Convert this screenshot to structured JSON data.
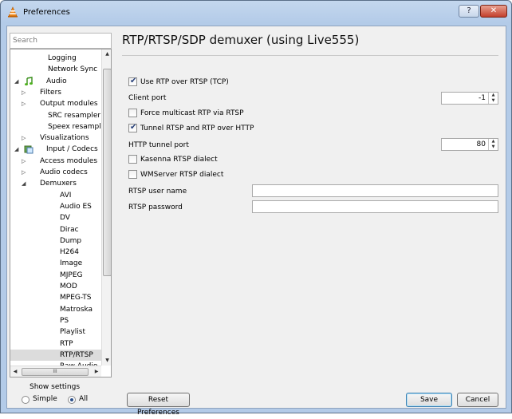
{
  "window": {
    "title": "Preferences",
    "help_glyph": "?",
    "close_glyph": "✕"
  },
  "search": {
    "placeholder": "Search"
  },
  "tree": {
    "items": [
      {
        "label": "Logging",
        "indent": 2
      },
      {
        "label": "Network Sync",
        "indent": 2
      },
      {
        "label": "Audio",
        "indent": 0,
        "expanded": true,
        "icon": "music-note-icon"
      },
      {
        "label": "Filters",
        "indent": 1,
        "collapsed": true
      },
      {
        "label": "Output modules",
        "indent": 1,
        "collapsed": true
      },
      {
        "label": "SRC resampler",
        "indent": 2
      },
      {
        "label": "Speex resampler",
        "indent": 2
      },
      {
        "label": "Visualizations",
        "indent": 1,
        "collapsed": true
      },
      {
        "label": "Input / Codecs",
        "indent": 0,
        "expanded": true,
        "icon": "input-codecs-icon"
      },
      {
        "label": "Access modules",
        "indent": 1,
        "collapsed": true
      },
      {
        "label": "Audio codecs",
        "indent": 1,
        "collapsed": true
      },
      {
        "label": "Demuxers",
        "indent": 1,
        "expanded": true
      },
      {
        "label": "AVI",
        "indent": 3
      },
      {
        "label": "Audio ES",
        "indent": 3
      },
      {
        "label": "DV",
        "indent": 3
      },
      {
        "label": "Dirac",
        "indent": 3
      },
      {
        "label": "Dump",
        "indent": 3
      },
      {
        "label": "H264",
        "indent": 3
      },
      {
        "label": "Image",
        "indent": 3
      },
      {
        "label": "MJPEG",
        "indent": 3
      },
      {
        "label": "MOD",
        "indent": 3
      },
      {
        "label": "MPEG-TS",
        "indent": 3
      },
      {
        "label": "Matroska",
        "indent": 3
      },
      {
        "label": "PS",
        "indent": 3
      },
      {
        "label": "Playlist",
        "indent": 3
      },
      {
        "label": "RTP",
        "indent": 3
      },
      {
        "label": "RTP/RTSP",
        "indent": 3,
        "selected": true
      },
      {
        "label": "Raw Audio",
        "indent": 3
      }
    ],
    "hscroll_grip": "III"
  },
  "show_settings": {
    "label": "Show settings",
    "simple_label": "Simple",
    "all_label": "All",
    "selected": "All"
  },
  "panel": {
    "title": "RTP/RTSP/SDP demuxer (using Live555)",
    "use_rtp_over_rtsp": {
      "label": "Use RTP over RTSP (TCP)",
      "checked": true
    },
    "client_port": {
      "label": "Client port",
      "value": "-1"
    },
    "force_multicast": {
      "label": "Force multicast RTP via RTSP",
      "checked": false
    },
    "tunnel_rtsp": {
      "label": "Tunnel RTSP and RTP over HTTP",
      "checked": true
    },
    "http_tunnel_port": {
      "label": "HTTP tunnel port",
      "value": "80"
    },
    "kasenna": {
      "label": "Kasenna RTSP dialect",
      "checked": false
    },
    "wmserver": {
      "label": "WMServer RTSP dialect",
      "checked": false
    },
    "user_name": {
      "label": "RTSP user name",
      "value": ""
    },
    "password": {
      "label": "RTSP password",
      "value": ""
    }
  },
  "buttons": {
    "reset": "Reset Preferences",
    "save": "Save",
    "cancel": "Cancel"
  },
  "colors": {
    "accent": "#2b4f8a",
    "title_bar": "#c4d7ee",
    "close": "#c3402c"
  }
}
